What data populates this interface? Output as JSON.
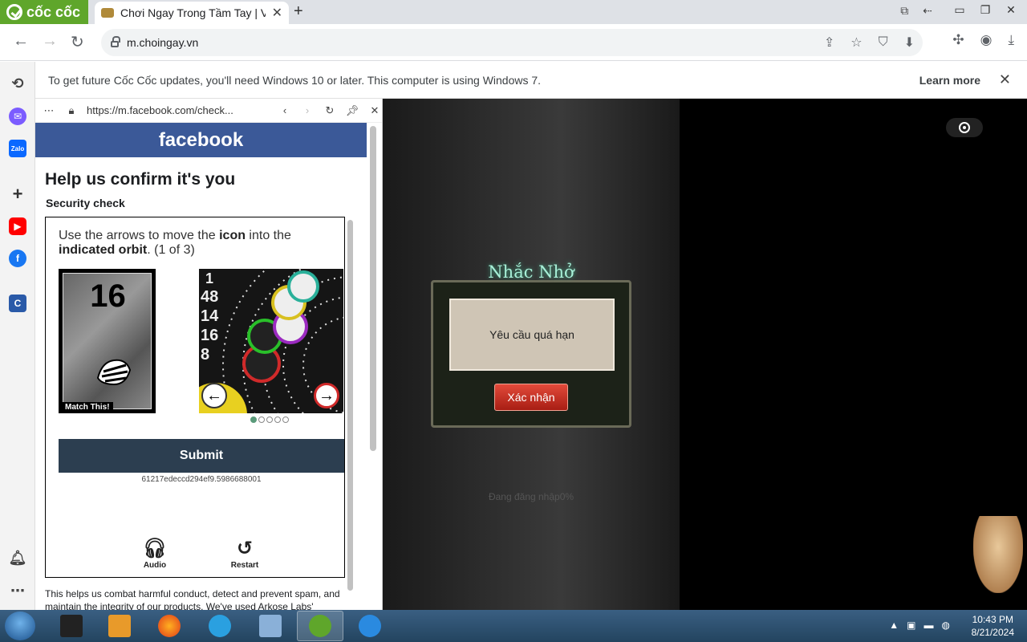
{
  "browser": {
    "brand": "cốc cốc",
    "tab_title": "Chơi Ngay Trong Tầm Tay | V",
    "url": "m.choingay.vn"
  },
  "infobar": {
    "message": "To get future Cốc Cốc updates, you'll need Windows 10 or later. This computer is using Windows 7.",
    "learn_more": "Learn more"
  },
  "fb_popup": {
    "url": "https://m.facebook.com/check...",
    "logo": "facebook",
    "heading": "Help us confirm it's you",
    "subheading": "Security check",
    "instruction_prefix": "Use the arrows to move the ",
    "instruction_bold1": "icon",
    "instruction_mid": " into the ",
    "instruction_bold2": "indicated orbit",
    "instruction_suffix": ". (1 of 3)",
    "card_number": "16",
    "card_caption": "Match This!",
    "orbit_numbers": [
      "1",
      "48",
      "14",
      "16",
      "8"
    ],
    "submit": "Submit",
    "token": "61217edeccd294ef9.5986688001",
    "audio_label": "Audio",
    "restart_label": "Restart",
    "footer_text": "This helps us combat harmful conduct, detect and prevent spam, and maintain the integrity of our products. We've used Arkose Labs'"
  },
  "game": {
    "dialog_title": "Nhắc Nhở",
    "dialog_message": "Yêu cầu quá hạn",
    "confirm_button": "Xác nhận",
    "loading_text": "Đang đăng nhập0%"
  },
  "taskbar": {
    "time": "10:43 PM",
    "date": "8/21/2024"
  },
  "colors": {
    "coccoc_green": "#5fa62b",
    "facebook_blue": "#3b5998",
    "submit_dark": "#2c3e50",
    "confirm_red": "#c0281c"
  }
}
